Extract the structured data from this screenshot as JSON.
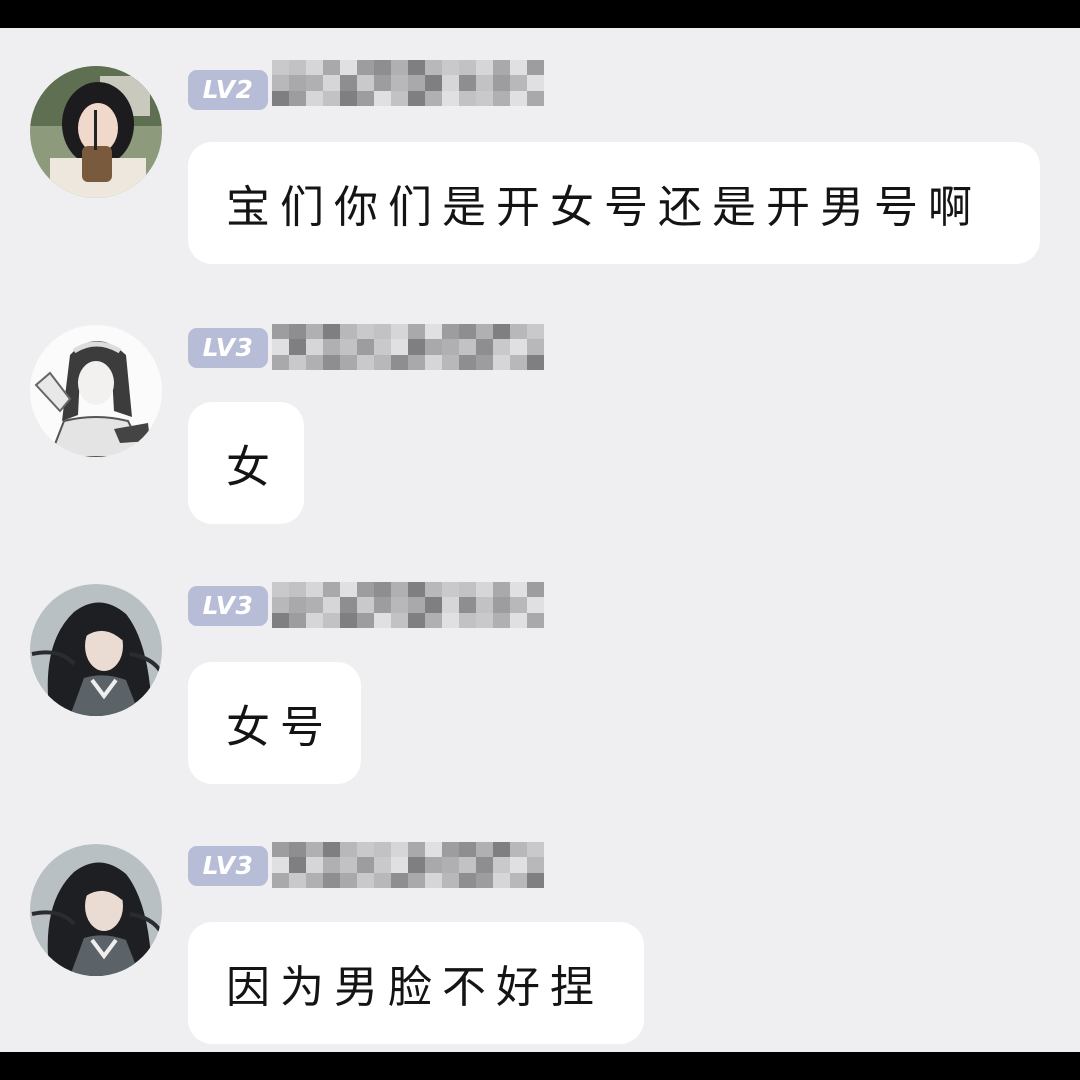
{
  "messages": [
    {
      "level": "LV2",
      "text": "宝们你们是开女号还是开男号啊",
      "avatar": "avatar-girl-photo"
    },
    {
      "level": "LV3",
      "text": "女",
      "avatar": "avatar-anime-girl-sketch"
    },
    {
      "level": "LV3",
      "text": "女号",
      "avatar": "avatar-long-hair-male-character"
    },
    {
      "level": "LV3",
      "text": "因为男脸不好捏",
      "avatar": "avatar-long-hair-male-character"
    }
  ],
  "colors": {
    "background": "#efeff1",
    "bubble": "#ffffff",
    "level_badge": "#b7bdd6",
    "text": "#141414"
  }
}
